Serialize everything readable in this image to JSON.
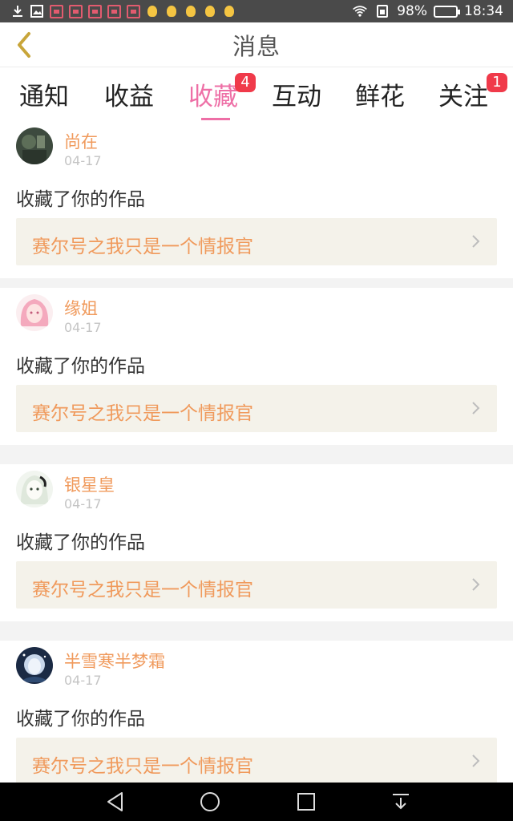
{
  "status_bar": {
    "battery": "98%",
    "time": "18:34",
    "battery_level": 0.98
  },
  "header": {
    "title": "消息"
  },
  "tabs": [
    {
      "label": "通知",
      "badge": ""
    },
    {
      "label": "收益",
      "badge": ""
    },
    {
      "label": "收藏",
      "badge": "4"
    },
    {
      "label": "互动",
      "badge": ""
    },
    {
      "label": "鲜花",
      "badge": ""
    },
    {
      "label": "关注",
      "badge": "1"
    }
  ],
  "active_tab": "收藏",
  "items": [
    {
      "name": "尚在",
      "date": "04-17",
      "action": "收藏了你的作品",
      "work": "赛尔号之我只是一个情报官"
    },
    {
      "name": "缘姐",
      "date": "04-17",
      "action": "收藏了你的作品",
      "work": "赛尔号之我只是一个情报官"
    },
    {
      "name": "银星皇",
      "date": "04-17",
      "action": "收藏了你的作品",
      "work": "赛尔号之我只是一个情报官"
    },
    {
      "name": "半雪寒半梦霜",
      "date": "04-17",
      "action": "收藏了你的作品",
      "work": "赛尔号之我只是一个情报官"
    }
  ],
  "colors": {
    "accent_pink": "#ee6fa6",
    "username_orange": "#f09a5c",
    "badge_red": "#f03a4a",
    "work_box_bg": "#f4f2ea",
    "back_arrow": "#c8a53a"
  },
  "icons": {
    "back": "chevron-left-icon",
    "item_arrow": "chevron-right-icon",
    "nav_back": "triangle-back-icon",
    "nav_home": "circle-home-icon",
    "nav_recents": "square-recents-icon",
    "nav_notifications": "pull-down-icon"
  }
}
